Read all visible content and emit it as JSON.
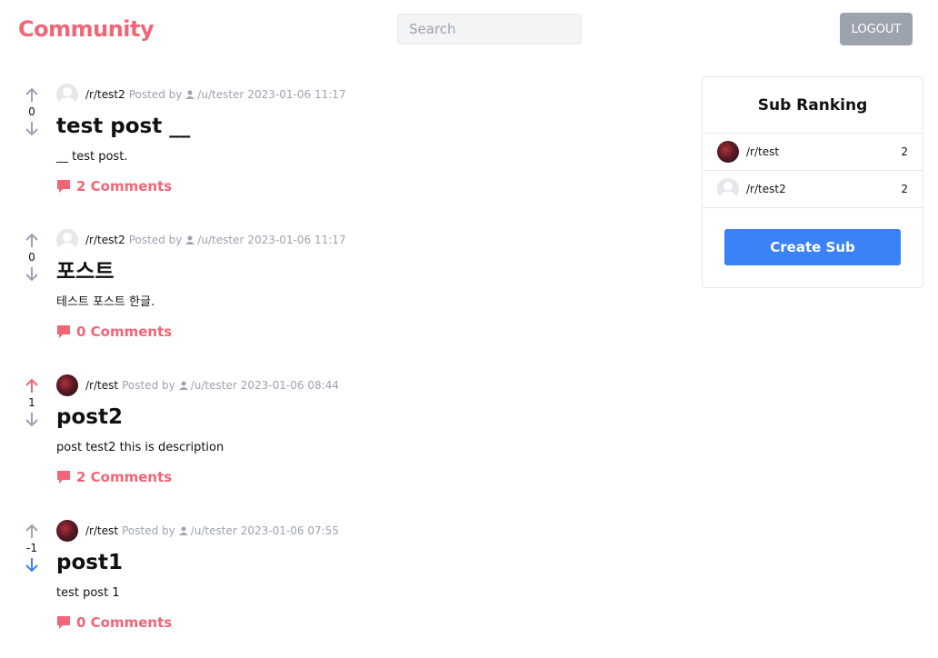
{
  "header": {
    "brand": "Community",
    "search_placeholder": "Search",
    "logout_label": "LOGOUT"
  },
  "colors": {
    "brand": "#f26577",
    "upvoted": "#f26577",
    "downvoted": "#3b82f6",
    "neutral": "#9ca3af",
    "primary_button": "#3b82f6"
  },
  "posts": [
    {
      "sub": "/r/test2",
      "sub_avatar": "default",
      "posted_by": "Posted by",
      "user": "/u/tester",
      "time": "2023-01-06 11:17",
      "votes": "0",
      "vote_state": "none",
      "title": "test post __",
      "desc": "__ test post.",
      "comments": "2 Comments"
    },
    {
      "sub": "/r/test2",
      "sub_avatar": "default",
      "posted_by": "Posted by",
      "user": "/u/tester",
      "time": "2023-01-06 11:17",
      "votes": "0",
      "vote_state": "none",
      "title": "포스트",
      "desc": "테스트 포스트 한글.",
      "comments": "0 Comments"
    },
    {
      "sub": "/r/test",
      "sub_avatar": "image",
      "posted_by": "Posted by",
      "user": "/u/tester",
      "time": "2023-01-06 08:44",
      "votes": "1",
      "vote_state": "up",
      "title": "post2",
      "desc": "post test2 this is description",
      "comments": "2 Comments"
    },
    {
      "sub": "/r/test",
      "sub_avatar": "image",
      "posted_by": "Posted by",
      "user": "/u/tester",
      "time": "2023-01-06 07:55",
      "votes": "-1",
      "vote_state": "down",
      "title": "post1",
      "desc": "test post 1",
      "comments": "0 Comments"
    }
  ],
  "sidebar": {
    "title": "Sub Ranking",
    "ranking": [
      {
        "name": "/r/test",
        "avatar": "image",
        "count": "2"
      },
      {
        "name": "/r/test2",
        "avatar": "default",
        "count": "2"
      }
    ],
    "create_label": "Create Sub"
  }
}
